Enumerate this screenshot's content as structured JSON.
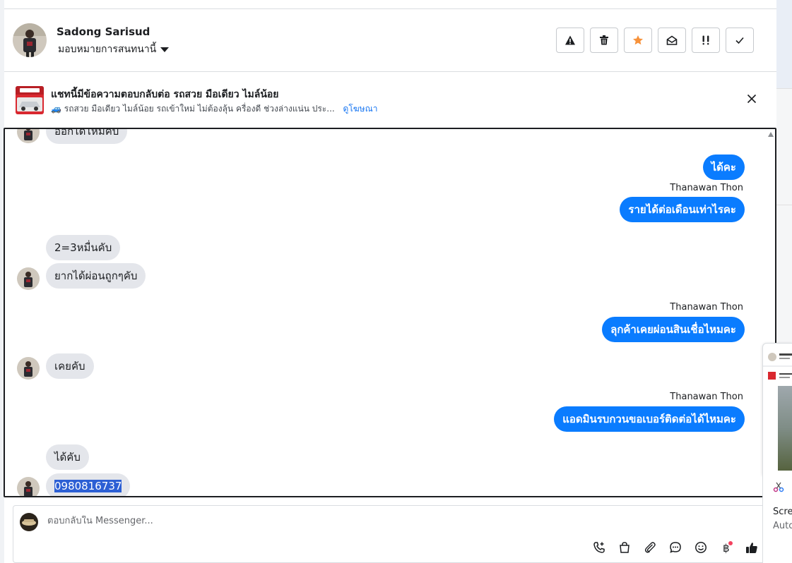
{
  "header": {
    "contact_name": "Sadong Sarisud",
    "assign_label": "มอบหมายการสนทนานี้",
    "actions": [
      "spam",
      "delete",
      "star",
      "mark-unread",
      "follow-up",
      "done"
    ]
  },
  "banner": {
    "title": "แชทนี้มีข้อความตอบกลับต่อ รถสวย มือเดียว ไมล์น้อย",
    "subtitle": "🚙 รถสวย มือเดียว ไมล์น้อย รถเข้าใหม่ ไม่ต้องลุ้น ครื่องดี ช่วงล่างแน่น ประ...",
    "ad_link": "ดูโฆษณา"
  },
  "messages": [
    {
      "side": "in",
      "text": "ออกได้ไหมคับ",
      "avatar": true
    },
    {
      "side": "out",
      "text": "ได้คะ",
      "sender": ""
    },
    {
      "side": "out",
      "text": "รายได้ต่อเดือนเท่าไรคะ",
      "sender": "Thanawan Thon"
    },
    {
      "side": "in",
      "text": "2=3หมื่นคับ",
      "avatar": false
    },
    {
      "side": "in",
      "text": "ยากได้ผ่อนถูกๆคับ",
      "avatar": true
    },
    {
      "side": "out",
      "text": "ลุกค้าเคยผ่อนสินเชื่อไหมคะ",
      "sender": "Thanawan Thon"
    },
    {
      "side": "in",
      "text": "เคยคับ",
      "avatar": true
    },
    {
      "side": "out",
      "text": "แอดมินรบกวนขอเบอร์ติดต่อได้ไหมคะ",
      "sender": "Thanawan Thon"
    },
    {
      "side": "in",
      "text": "ได้คับ",
      "avatar": false
    },
    {
      "side": "in",
      "text": "0980816737",
      "avatar": true,
      "selected": true
    }
  ],
  "composer": {
    "placeholder": "ตอบกลับใน Messenger...",
    "tools": [
      "call-add-icon",
      "shopping-bag-icon",
      "attachment-icon",
      "saved-reply-icon",
      "emoji-icon",
      "baht-icon",
      "thumbs-up-icon"
    ]
  },
  "side_widget": {
    "title_partial": "Scre",
    "sub_partial": "Auto"
  },
  "colors": {
    "outgoing_bubble": "#0a7cff",
    "incoming_bubble": "#e4e6eb",
    "link": "#1876f2",
    "star": "#f7923b"
  }
}
